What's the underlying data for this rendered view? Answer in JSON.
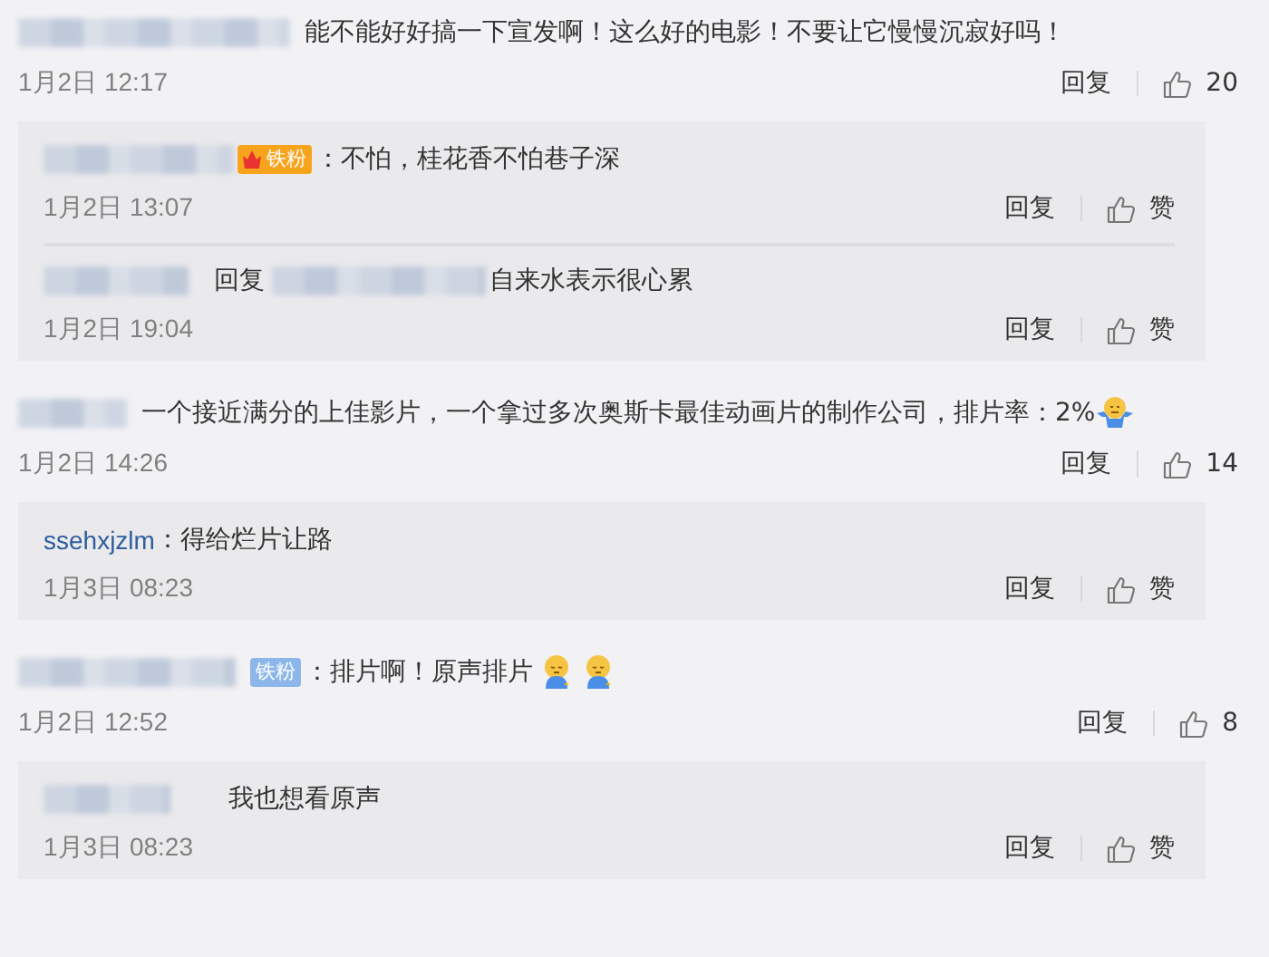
{
  "comments": [
    {
      "text": "能不能好好搞一下宣发啊！这么好的电影！不要让它慢慢沉寂好吗！",
      "time": "1月2日 12:17",
      "reply_label": "回复",
      "likes": "20",
      "replies": [
        {
          "badge": {
            "kind": "crown",
            "label": "铁粉"
          },
          "text": "：不怕，桂花香不怕巷子深",
          "time": "1月2日 13:07",
          "reply_label": "回复",
          "like_label": "赞"
        },
        {
          "reply_prefix": "回复",
          "text": "自来水表示很心累",
          "time": "1月2日 19:04",
          "reply_label": "回复",
          "like_label": "赞"
        }
      ]
    },
    {
      "text": "一个接近满分的上佳影片，一个拿过多次奥斯卡最佳动画片的制作公司，排片率：2%",
      "emojis": [
        {
          "kind": "shrug"
        }
      ],
      "time": "1月2日 14:26",
      "reply_label": "回复",
      "likes": "14",
      "replies": [
        {
          "author": "ssehxjzlm",
          "text": "：得给烂片让路",
          "time": "1月3日 08:23",
          "reply_label": "回复",
          "like_label": "赞"
        }
      ]
    },
    {
      "badge": {
        "kind": "plain",
        "label": "铁粉"
      },
      "text": "：排片啊！原声排片",
      "emojis": [
        {
          "kind": "sad"
        },
        {
          "kind": "sad"
        }
      ],
      "time": "1月2日 12:52",
      "reply_label": "回复",
      "likes": "8",
      "replies": [
        {
          "text": "我也想看原声",
          "time": "1月3日 08:23",
          "reply_label": "回复",
          "like_label": "赞"
        }
      ]
    }
  ]
}
